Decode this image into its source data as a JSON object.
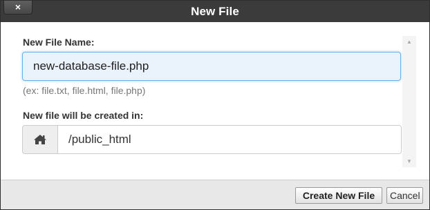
{
  "window": {
    "title": "New File",
    "close_label": "×"
  },
  "form": {
    "file_name_label": "New File Name:",
    "file_name_value": "new-database-file.php",
    "file_name_hint": "(ex: file.txt, file.html, file.php)",
    "location_label": "New file will be created in:",
    "location_value": "/public_html",
    "location_icon": "home-icon"
  },
  "footer": {
    "create_label": "Create New File",
    "cancel_label": "Cancel"
  },
  "colors": {
    "titlebar": "#3b3b3b",
    "focus_border": "#66afe9",
    "focus_background": "#eaf2fb",
    "footer_background": "#e8e8e8"
  }
}
